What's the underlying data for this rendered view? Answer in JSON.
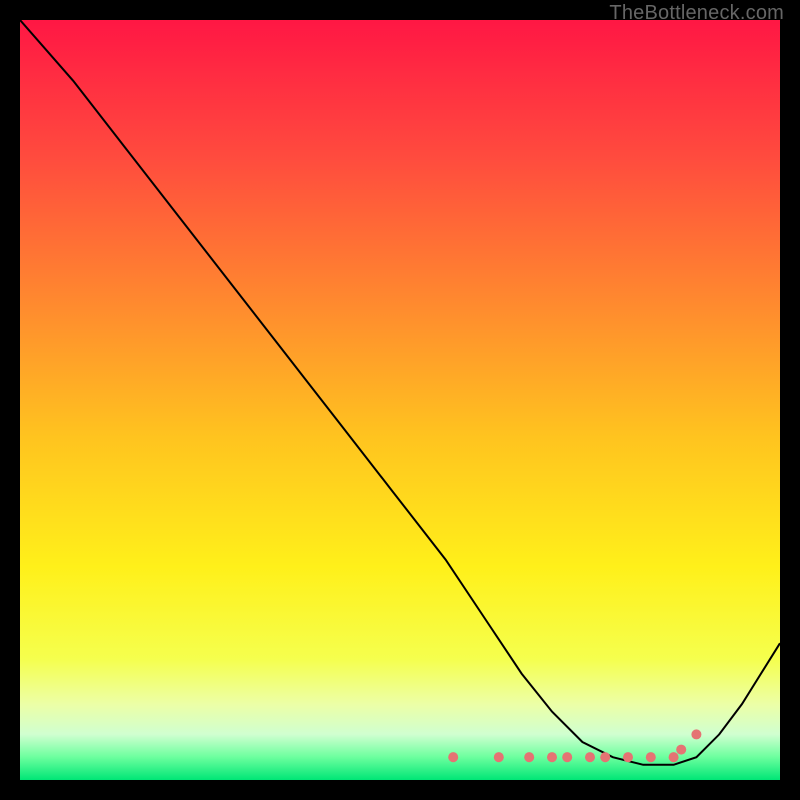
{
  "watermark": "TheBottleneck.com",
  "chart_data": {
    "type": "line",
    "title": "",
    "xlabel": "",
    "ylabel": "",
    "xlim": [
      0,
      100
    ],
    "ylim": [
      0,
      100
    ],
    "grid": false,
    "legend": false,
    "gradient_stops": [
      {
        "offset": 0.0,
        "color": "#ff1744"
      },
      {
        "offset": 0.18,
        "color": "#ff4b3e"
      },
      {
        "offset": 0.38,
        "color": "#ff8c2e"
      },
      {
        "offset": 0.55,
        "color": "#ffc41f"
      },
      {
        "offset": 0.72,
        "color": "#fff01a"
      },
      {
        "offset": 0.84,
        "color": "#f5ff4d"
      },
      {
        "offset": 0.9,
        "color": "#ecffa6"
      },
      {
        "offset": 0.94,
        "color": "#d0ffd0"
      },
      {
        "offset": 0.97,
        "color": "#6cff9e"
      },
      {
        "offset": 1.0,
        "color": "#00e676"
      }
    ],
    "series": [
      {
        "name": "curve",
        "stroke": "#000000",
        "stroke_width": 2,
        "x": [
          0,
          7,
          14,
          21,
          28,
          35,
          42,
          49,
          56,
          62,
          66,
          70,
          74,
          78,
          82,
          86,
          89,
          92,
          95,
          100
        ],
        "y": [
          100,
          92,
          83,
          74,
          65,
          56,
          47,
          38,
          29,
          20,
          14,
          9,
          5,
          3,
          2,
          2,
          3,
          6,
          10,
          18
        ]
      }
    ],
    "markers": {
      "color": "#e57373",
      "radius": 5,
      "x": [
        57,
        63,
        67,
        70,
        72,
        75,
        77,
        80,
        83,
        86,
        87,
        89
      ],
      "y": [
        3,
        3,
        3,
        3,
        3,
        3,
        3,
        3,
        3,
        3,
        4,
        6
      ]
    }
  }
}
